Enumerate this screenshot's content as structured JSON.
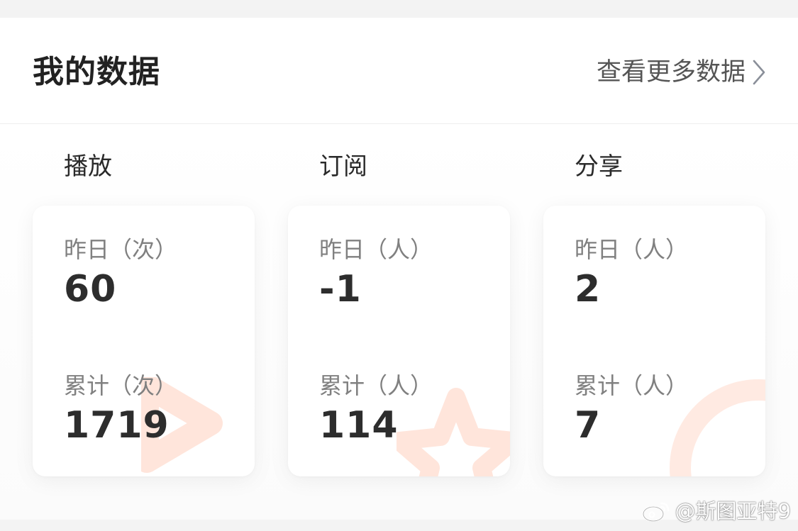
{
  "header": {
    "title": "我的数据",
    "more_label": "查看更多数据"
  },
  "sections": [
    {
      "label": "播放",
      "icon": "play-triangle-icon",
      "yesterday_label": "昨日（次）",
      "yesterday_value": "60",
      "total_label": "累计（次）",
      "total_value": "1719"
    },
    {
      "label": "订阅",
      "icon": "star-icon",
      "yesterday_label": "昨日（人）",
      "yesterday_value": "-1",
      "total_label": "累计（人）",
      "total_value": "114"
    },
    {
      "label": "分享",
      "icon": "circle-ring-icon",
      "yesterday_label": "昨日（人）",
      "yesterday_value": "2",
      "total_label": "累计（人）",
      "total_value": "7"
    }
  ],
  "watermark": {
    "text": "@斯图亚特9",
    "icon": "weibo-logo-icon"
  },
  "colors": {
    "accent_deco": "#ff7b4d",
    "title_text": "#222222",
    "label_text": "#808080",
    "link_text": "#555555"
  }
}
